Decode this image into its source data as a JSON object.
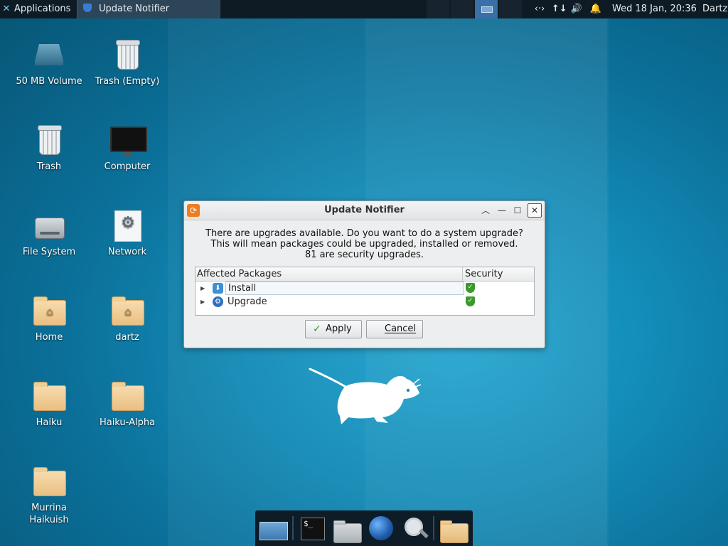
{
  "top_panel": {
    "applications_label": "Applications",
    "task_label": "Update Notifier",
    "clock": "Wed 18 Jan, 20:36",
    "user": "Dartz"
  },
  "desktop_icons": [
    {
      "label": "50 MB Volume",
      "icon": "drive-volume-icon"
    },
    {
      "label": "Trash (Empty)",
      "icon": "trash-empty-icon"
    },
    {
      "label": "Trash",
      "icon": "trash-icon"
    },
    {
      "label": "Computer",
      "icon": "computer-icon"
    },
    {
      "label": "File System",
      "icon": "hard-drive-icon"
    },
    {
      "label": "Network",
      "icon": "network-gear-icon"
    },
    {
      "label": "Home",
      "icon": "home-folder-icon"
    },
    {
      "label": "dartz",
      "icon": "home-folder-icon"
    },
    {
      "label": "Haiku",
      "icon": "folder-icon"
    },
    {
      "label": "Haiku-Alpha",
      "icon": "folder-icon"
    },
    {
      "label": "Murrina Haikuish",
      "icon": "folder-icon"
    }
  ],
  "dialog": {
    "title": "Update Notifier",
    "message_line1": "There are upgrades available. Do you want to do a system upgrade?",
    "message_line2": "This will mean packages could be upgraded, installed or removed.",
    "message_line3": "81 are security upgrades.",
    "columns": [
      "Affected Packages",
      "Security"
    ],
    "rows": [
      {
        "label": "Install",
        "icon": "install-icon",
        "security": "shield-check-icon"
      },
      {
        "label": "Upgrade",
        "icon": "upgrade-gear-icon",
        "security": "shield-check-icon"
      }
    ],
    "apply_label": "Apply",
    "cancel_label": "Cancel"
  },
  "colors": {
    "panel": "#0f1b24",
    "desktop": "#1491bd",
    "accent": "#3a6fa8",
    "security_ok": "#3c9a2c",
    "dialog_icon": "#f07c20"
  }
}
